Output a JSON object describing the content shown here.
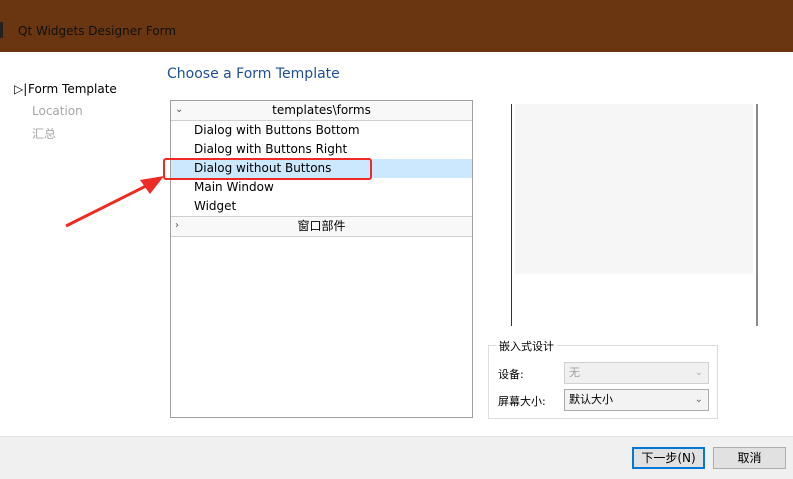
{
  "window": {
    "title": "Qt Widgets Designer Form"
  },
  "steps": [
    {
      "marker": "▷|",
      "label": "Form Template",
      "active": true
    },
    {
      "label": "Location",
      "active": false
    },
    {
      "label": "汇总",
      "active": false
    }
  ],
  "heading": "Choose a Form Template",
  "templates": {
    "groups": [
      {
        "label": "templates\\forms",
        "expanded": true,
        "items": [
          {
            "label": "Dialog with Buttons Bottom"
          },
          {
            "label": "Dialog with Buttons Right"
          },
          {
            "label": "Dialog without Buttons",
            "selected": true
          },
          {
            "label": "Main Window"
          },
          {
            "label": "Widget"
          }
        ]
      },
      {
        "label": "窗口部件",
        "expanded": false
      }
    ]
  },
  "embedded": {
    "title": "嵌入式设计",
    "device_label": "设备:",
    "device_value": "无",
    "screen_label": "屏幕大小:",
    "screen_value": "默认大小"
  },
  "buttons": {
    "next": "下一步(N)",
    "cancel": "取消"
  },
  "colors": {
    "titlebar": "#6a3511",
    "heading": "#1e4f96",
    "selection": "#cce8ff",
    "annotation": "#ee2a24"
  }
}
